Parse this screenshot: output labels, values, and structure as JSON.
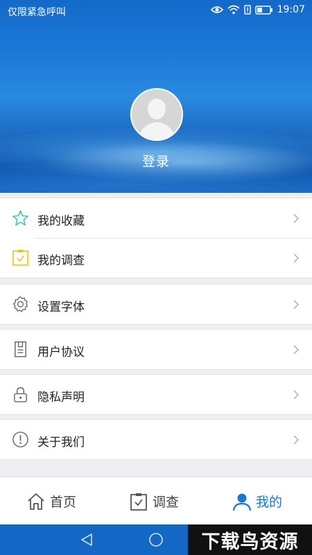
{
  "status_bar": {
    "carrier_text": "仅限紧急呼叫",
    "time": "19:07",
    "icons": [
      "eye-icon",
      "wifi-icon",
      "sim-alert-icon",
      "battery-icon"
    ]
  },
  "profile": {
    "login_label": "登录"
  },
  "menu": {
    "favorites": "我的收藏",
    "surveys": "我的调查",
    "font_settings": "设置字体",
    "user_agreement": "用户协议",
    "privacy": "隐私声明",
    "about": "关于我们"
  },
  "tabbar": {
    "home": "首页",
    "survey": "调查",
    "mine": "我的",
    "active_tab": "mine"
  },
  "colors": {
    "accent": "#1778d4",
    "star": "#3ec9b5",
    "survey_icon": "#f0c419",
    "header": "#1a78d6"
  },
  "watermark_text": "下载鸟资源"
}
